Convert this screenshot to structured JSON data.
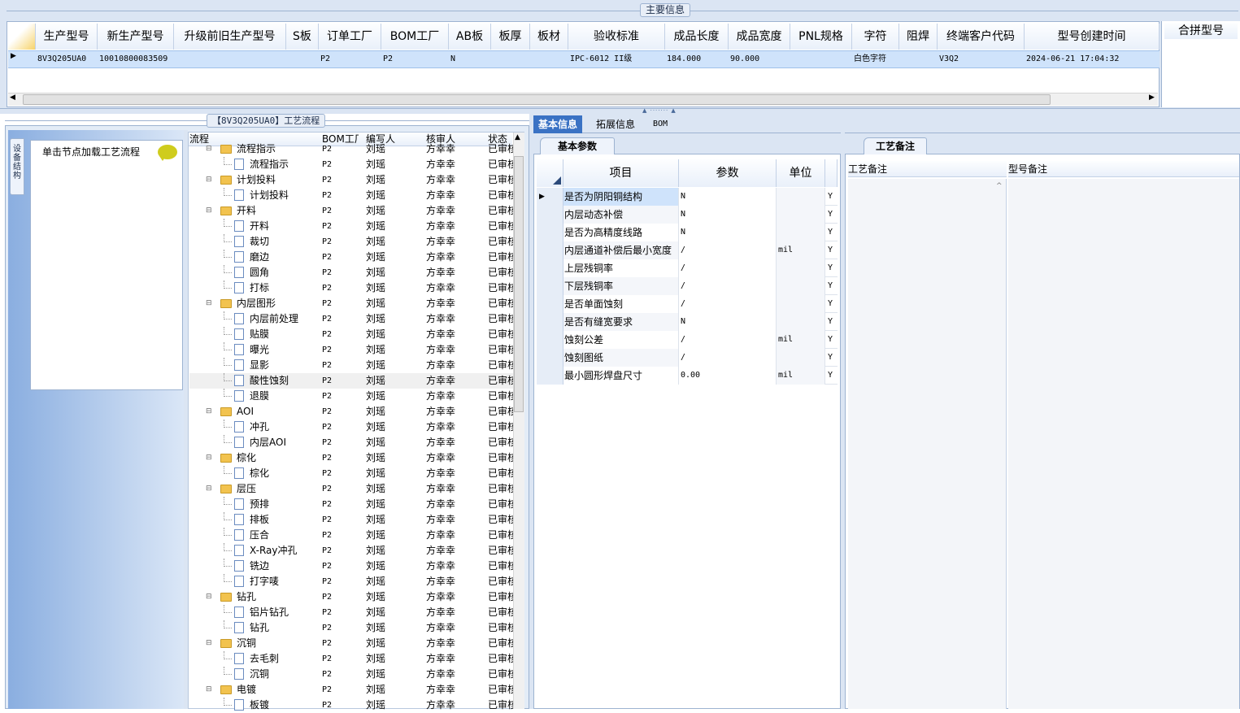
{
  "main_info": {
    "title": "主要信息",
    "columns": [
      "生产型号",
      "新生产型号",
      "升级前旧生产型号",
      "S板",
      "订单工厂",
      "BOM工厂",
      "AB板",
      "板厚",
      "板材",
      "验收标准",
      "成品长度",
      "成品宽度",
      "PNL规格",
      "字符",
      "阻焊",
      "终端客户代码",
      "型号创建时间",
      "合拼型号"
    ],
    "row": [
      "8V3Q205UA0",
      "10010800083509",
      "",
      "",
      "P2",
      "P2",
      "N",
      "",
      "",
      "IPC-6012 II级",
      "184.000",
      "90.000",
      "",
      "白色字符",
      "",
      "V3Q2",
      "2024-06-21 17:04:32",
      ""
    ]
  },
  "process_panel": {
    "title": "【8V3Q205UA0】工艺流程"
  },
  "side_tab": {
    "label": "设备结构"
  },
  "hint": {
    "text": "单击节点加载工艺流程"
  },
  "tree": {
    "columns": [
      "流程",
      "BOM工厂",
      "编写人",
      "核审人",
      "状态"
    ],
    "rows": [
      {
        "name": "流程指示",
        "level": 0,
        "bom": "P2",
        "writer": "刘瑶",
        "reviewer": "方幸幸",
        "status": "已审核"
      },
      {
        "name": "流程指示",
        "level": 1,
        "bom": "P2",
        "writer": "刘瑶",
        "reviewer": "方幸幸",
        "status": "已审核"
      },
      {
        "name": "计划投料",
        "level": 0,
        "bom": "P2",
        "writer": "刘瑶",
        "reviewer": "方幸幸",
        "status": "已审核"
      },
      {
        "name": "计划投料",
        "level": 1,
        "bom": "P2",
        "writer": "刘瑶",
        "reviewer": "方幸幸",
        "status": "已审核"
      },
      {
        "name": "开料",
        "level": 0,
        "bom": "P2",
        "writer": "刘瑶",
        "reviewer": "方幸幸",
        "status": "已审核"
      },
      {
        "name": "开料",
        "level": 1,
        "bom": "P2",
        "writer": "刘瑶",
        "reviewer": "方幸幸",
        "status": "已审核"
      },
      {
        "name": "裁切",
        "level": 1,
        "bom": "P2",
        "writer": "刘瑶",
        "reviewer": "方幸幸",
        "status": "已审核"
      },
      {
        "name": "磨边",
        "level": 1,
        "bom": "P2",
        "writer": "刘瑶",
        "reviewer": "方幸幸",
        "status": "已审核"
      },
      {
        "name": "圆角",
        "level": 1,
        "bom": "P2",
        "writer": "刘瑶",
        "reviewer": "方幸幸",
        "status": "已审核"
      },
      {
        "name": "打标",
        "level": 1,
        "bom": "P2",
        "writer": "刘瑶",
        "reviewer": "方幸幸",
        "status": "已审核"
      },
      {
        "name": "内层图形",
        "level": 0,
        "bom": "P2",
        "writer": "刘瑶",
        "reviewer": "方幸幸",
        "status": "已审核"
      },
      {
        "name": "内层前处理",
        "level": 1,
        "bom": "P2",
        "writer": "刘瑶",
        "reviewer": "方幸幸",
        "status": "已审核"
      },
      {
        "name": "贴膜",
        "level": 1,
        "bom": "P2",
        "writer": "刘瑶",
        "reviewer": "方幸幸",
        "status": "已审核"
      },
      {
        "name": "曝光",
        "level": 1,
        "bom": "P2",
        "writer": "刘瑶",
        "reviewer": "方幸幸",
        "status": "已审核"
      },
      {
        "name": "显影",
        "level": 1,
        "bom": "P2",
        "writer": "刘瑶",
        "reviewer": "方幸幸",
        "status": "已审核"
      },
      {
        "name": "酸性蚀刻",
        "level": 1,
        "bom": "P2",
        "writer": "刘瑶",
        "reviewer": "方幸幸",
        "status": "已审核"
      },
      {
        "name": "退膜",
        "level": 1,
        "bom": "P2",
        "writer": "刘瑶",
        "reviewer": "方幸幸",
        "status": "已审核"
      },
      {
        "name": "AOI",
        "level": 0,
        "bom": "P2",
        "writer": "刘瑶",
        "reviewer": "方幸幸",
        "status": "已审核"
      },
      {
        "name": "冲孔",
        "level": 1,
        "bom": "P2",
        "writer": "刘瑶",
        "reviewer": "方幸幸",
        "status": "已审核"
      },
      {
        "name": "内层AOI",
        "level": 1,
        "bom": "P2",
        "writer": "刘瑶",
        "reviewer": "方幸幸",
        "status": "已审核"
      },
      {
        "name": "棕化",
        "level": 0,
        "bom": "P2",
        "writer": "刘瑶",
        "reviewer": "方幸幸",
        "status": "已审核"
      },
      {
        "name": "棕化",
        "level": 1,
        "bom": "P2",
        "writer": "刘瑶",
        "reviewer": "方幸幸",
        "status": "已审核"
      },
      {
        "name": "层压",
        "level": 0,
        "bom": "P2",
        "writer": "刘瑶",
        "reviewer": "方幸幸",
        "status": "已审核"
      },
      {
        "name": "预排",
        "level": 1,
        "bom": "P2",
        "writer": "刘瑶",
        "reviewer": "方幸幸",
        "status": "已审核"
      },
      {
        "name": "排板",
        "level": 1,
        "bom": "P2",
        "writer": "刘瑶",
        "reviewer": "方幸幸",
        "status": "已审核"
      },
      {
        "name": "压合",
        "level": 1,
        "bom": "P2",
        "writer": "刘瑶",
        "reviewer": "方幸幸",
        "status": "已审核"
      },
      {
        "name": "X-Ray冲孔",
        "level": 1,
        "bom": "P2",
        "writer": "刘瑶",
        "reviewer": "方幸幸",
        "status": "已审核"
      },
      {
        "name": "铣边",
        "level": 1,
        "bom": "P2",
        "writer": "刘瑶",
        "reviewer": "方幸幸",
        "status": "已审核"
      },
      {
        "name": "打字唛",
        "level": 1,
        "bom": "P2",
        "writer": "刘瑶",
        "reviewer": "方幸幸",
        "status": "已审核"
      },
      {
        "name": "钻孔",
        "level": 0,
        "bom": "P2",
        "writer": "刘瑶",
        "reviewer": "方幸幸",
        "status": "已审核"
      },
      {
        "name": "铝片钻孔",
        "level": 1,
        "bom": "P2",
        "writer": "刘瑶",
        "reviewer": "方幸幸",
        "status": "已审核"
      },
      {
        "name": "钻孔",
        "level": 1,
        "bom": "P2",
        "writer": "刘瑶",
        "reviewer": "方幸幸",
        "status": "已审核"
      },
      {
        "name": "沉铜",
        "level": 0,
        "bom": "P2",
        "writer": "刘瑶",
        "reviewer": "方幸幸",
        "status": "已审核"
      },
      {
        "name": "去毛刺",
        "level": 1,
        "bom": "P2",
        "writer": "刘瑶",
        "reviewer": "方幸幸",
        "status": "已审核"
      },
      {
        "name": "沉铜",
        "level": 1,
        "bom": "P2",
        "writer": "刘瑶",
        "reviewer": "方幸幸",
        "status": "已审核"
      },
      {
        "name": "电镀",
        "level": 0,
        "bom": "P2",
        "writer": "刘瑶",
        "reviewer": "方幸幸",
        "status": "已审核"
      },
      {
        "name": "板镀",
        "level": 1,
        "bom": "P2",
        "writer": "刘瑶",
        "reviewer": "方幸幸",
        "status": "已审核"
      }
    ]
  },
  "detail_tabs": [
    "基本信息",
    "拓展信息",
    "BOM"
  ],
  "basic_params": {
    "title": "基本参数",
    "columns": [
      "项目",
      "参数",
      "单位"
    ],
    "rows": [
      {
        "item": "是否为阴阳铜结构",
        "value": "N",
        "unit": "",
        "flag": "Y"
      },
      {
        "item": "内层动态补偿",
        "value": "N",
        "unit": "",
        "flag": "Y"
      },
      {
        "item": "是否为高精度线路",
        "value": "N",
        "unit": "",
        "flag": "Y"
      },
      {
        "item": "内层通道补偿后最小宽度",
        "value": "/",
        "unit": "mil",
        "flag": "Y"
      },
      {
        "item": "上层残铜率",
        "value": "/",
        "unit": "",
        "flag": "Y"
      },
      {
        "item": "下层残铜率",
        "value": "/",
        "unit": "",
        "flag": "Y"
      },
      {
        "item": "是否单面蚀刻",
        "value": "/",
        "unit": "",
        "flag": "Y"
      },
      {
        "item": "是否有缝宽要求",
        "value": "N",
        "unit": "",
        "flag": "Y"
      },
      {
        "item": "蚀刻公差",
        "value": "/",
        "unit": "mil",
        "flag": "Y"
      },
      {
        "item": "蚀刻图纸",
        "value": "/",
        "unit": "",
        "flag": "Y"
      },
      {
        "item": "最小圆形焊盘尺寸",
        "value": "0.00",
        "unit": "mil",
        "flag": "Y"
      }
    ]
  },
  "remarks": {
    "title": "工艺备注",
    "columns": [
      "工艺备注",
      "型号备注"
    ]
  }
}
